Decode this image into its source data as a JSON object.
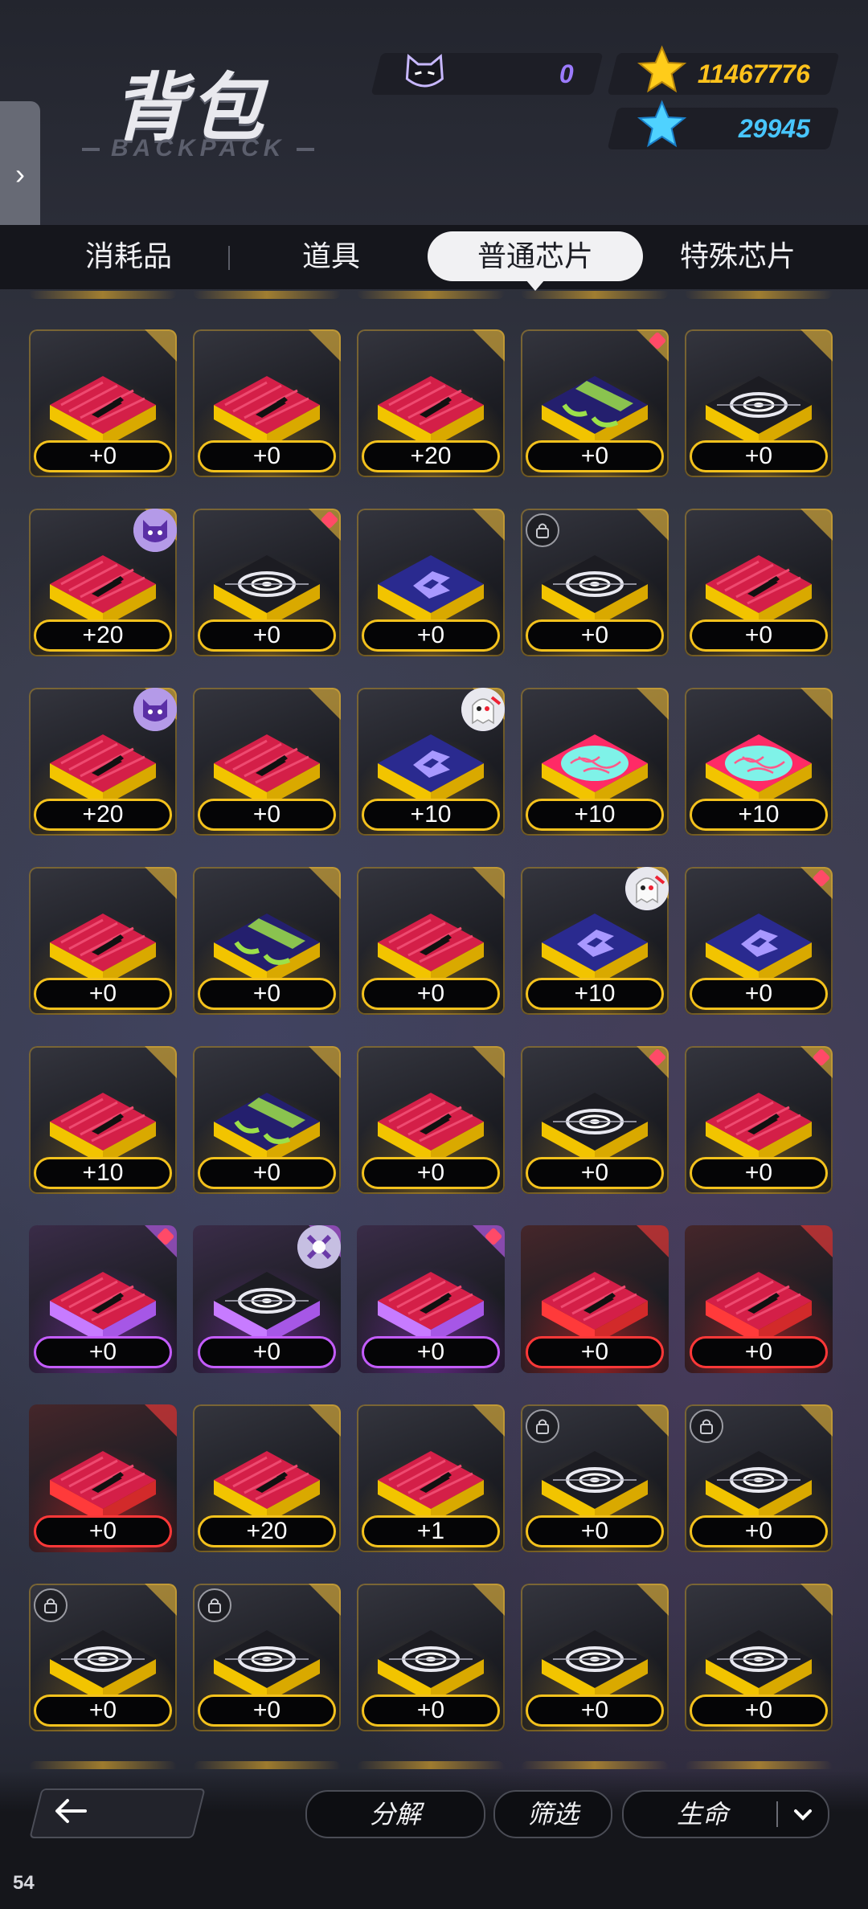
{
  "header": {
    "title": "背包",
    "subtitle": "BACKPACK"
  },
  "currencies": {
    "cat_token": "0",
    "gold_star": "11467776",
    "blue_star": "29945"
  },
  "tabs": [
    {
      "label": "消耗品"
    },
    {
      "label": "道具"
    },
    {
      "label": "普通芯片"
    },
    {
      "label": "特殊芯片"
    }
  ],
  "active_tab": 2,
  "chips": [
    {
      "rarity": "gold",
      "icon": "bullet-chip-icon",
      "level": "+0",
      "new": false,
      "lock": false,
      "avatar": null
    },
    {
      "rarity": "gold",
      "icon": "bullet-chip-icon",
      "level": "+0",
      "new": false,
      "lock": false,
      "avatar": null
    },
    {
      "rarity": "gold",
      "icon": "bullet-chip-icon",
      "level": "+20",
      "new": false,
      "lock": false,
      "avatar": null
    },
    {
      "rarity": "gold",
      "icon": "green-v-chip-icon",
      "level": "+0",
      "new": true,
      "lock": false,
      "avatar": null
    },
    {
      "rarity": "gold",
      "icon": "vortex-chip-icon",
      "level": "+0",
      "new": false,
      "lock": false,
      "avatar": null
    },
    {
      "rarity": "gold",
      "icon": "bullet-chip-icon",
      "level": "+20",
      "new": false,
      "lock": false,
      "avatar": "purple-cat"
    },
    {
      "rarity": "gold",
      "icon": "vortex-chip-icon",
      "level": "+0",
      "new": true,
      "lock": false,
      "avatar": null
    },
    {
      "rarity": "gold",
      "icon": "blue-logo-chip-icon",
      "level": "+0",
      "new": false,
      "lock": false,
      "avatar": null
    },
    {
      "rarity": "gold",
      "icon": "vortex-chip-icon",
      "level": "+0",
      "new": false,
      "lock": true,
      "avatar": null
    },
    {
      "rarity": "gold",
      "icon": "bullet-chip-icon",
      "level": "+0",
      "new": false,
      "lock": false,
      "avatar": null
    },
    {
      "rarity": "gold",
      "icon": "bullet-chip-icon",
      "level": "+20",
      "new": false,
      "lock": false,
      "avatar": "purple-cat"
    },
    {
      "rarity": "gold",
      "icon": "bullet-chip-icon",
      "level": "+0",
      "new": false,
      "lock": false,
      "avatar": null
    },
    {
      "rarity": "gold",
      "icon": "blue-logo-chip-icon",
      "level": "+10",
      "new": false,
      "lock": false,
      "avatar": "ghost"
    },
    {
      "rarity": "gold",
      "icon": "brain-chip-icon",
      "level": "+10",
      "new": false,
      "lock": false,
      "avatar": null
    },
    {
      "rarity": "gold",
      "icon": "brain-chip-icon",
      "level": "+10",
      "new": false,
      "lock": false,
      "avatar": null
    },
    {
      "rarity": "gold",
      "icon": "bullet-chip-icon",
      "level": "+0",
      "new": false,
      "lock": false,
      "avatar": null
    },
    {
      "rarity": "gold",
      "icon": "green-v-chip-icon",
      "level": "+0",
      "new": false,
      "lock": false,
      "avatar": null
    },
    {
      "rarity": "gold",
      "icon": "bullet-chip-icon",
      "level": "+0",
      "new": false,
      "lock": false,
      "avatar": null
    },
    {
      "rarity": "gold",
      "icon": "blue-logo-chip-icon",
      "level": "+10",
      "new": false,
      "lock": false,
      "avatar": "ghost"
    },
    {
      "rarity": "gold",
      "icon": "blue-logo-chip-icon",
      "level": "+0",
      "new": true,
      "lock": false,
      "avatar": null
    },
    {
      "rarity": "gold",
      "icon": "bullet-chip-icon",
      "level": "+10",
      "new": false,
      "lock": false,
      "avatar": null
    },
    {
      "rarity": "gold",
      "icon": "green-v-chip-icon",
      "level": "+0",
      "new": false,
      "lock": false,
      "avatar": null
    },
    {
      "rarity": "gold",
      "icon": "bullet-chip-icon",
      "level": "+0",
      "new": false,
      "lock": false,
      "avatar": null
    },
    {
      "rarity": "gold",
      "icon": "vortex-chip-icon",
      "level": "+0",
      "new": true,
      "lock": false,
      "avatar": null
    },
    {
      "rarity": "gold",
      "icon": "bullet-chip-icon",
      "level": "+0",
      "new": true,
      "lock": false,
      "avatar": null
    },
    {
      "rarity": "purple",
      "icon": "bullet-chip-icon",
      "level": "+0",
      "new": true,
      "lock": false,
      "avatar": null
    },
    {
      "rarity": "purple",
      "icon": "vortex-chip-icon",
      "level": "+0",
      "new": false,
      "lock": false,
      "avatar": "monster"
    },
    {
      "rarity": "purple",
      "icon": "bullet-chip-icon",
      "level": "+0",
      "new": true,
      "lock": false,
      "avatar": null
    },
    {
      "rarity": "red",
      "icon": "bullet-chip-icon",
      "level": "+0",
      "new": false,
      "lock": false,
      "avatar": null
    },
    {
      "rarity": "red",
      "icon": "bullet-chip-icon",
      "level": "+0",
      "new": false,
      "lock": false,
      "avatar": null
    },
    {
      "rarity": "red",
      "icon": "bullet-chip-icon",
      "level": "+0",
      "new": false,
      "lock": false,
      "avatar": null
    },
    {
      "rarity": "gold",
      "icon": "bullet-chip-icon",
      "level": "+20",
      "new": false,
      "lock": false,
      "avatar": null
    },
    {
      "rarity": "gold",
      "icon": "bullet-chip-icon",
      "level": "+1",
      "new": false,
      "lock": false,
      "avatar": null
    },
    {
      "rarity": "gold",
      "icon": "vortex-chip-icon",
      "level": "+0",
      "new": false,
      "lock": true,
      "avatar": null
    },
    {
      "rarity": "gold",
      "icon": "vortex-chip-icon",
      "level": "+0",
      "new": false,
      "lock": true,
      "avatar": null
    },
    {
      "rarity": "gold",
      "icon": "vortex-chip-icon",
      "level": "+0",
      "new": false,
      "lock": true,
      "avatar": null
    },
    {
      "rarity": "gold",
      "icon": "vortex-chip-icon",
      "level": "+0",
      "new": false,
      "lock": true,
      "avatar": null
    },
    {
      "rarity": "gold",
      "icon": "vortex-chip-icon",
      "level": "+0",
      "new": false,
      "lock": false,
      "avatar": null
    },
    {
      "rarity": "gold",
      "icon": "vortex-chip-icon",
      "level": "+0",
      "new": false,
      "lock": false,
      "avatar": null
    },
    {
      "rarity": "gold",
      "icon": "vortex-chip-icon",
      "level": "+0",
      "new": false,
      "lock": false,
      "avatar": null
    }
  ],
  "bottom": {
    "decompose": "分解",
    "filter": "筛选",
    "sort": "生命"
  },
  "fps": "54",
  "colors": {
    "gold": "#f4c21d",
    "purple": "#c45cff",
    "red": "#ff3838",
    "new_badge": "#ff4a68"
  }
}
